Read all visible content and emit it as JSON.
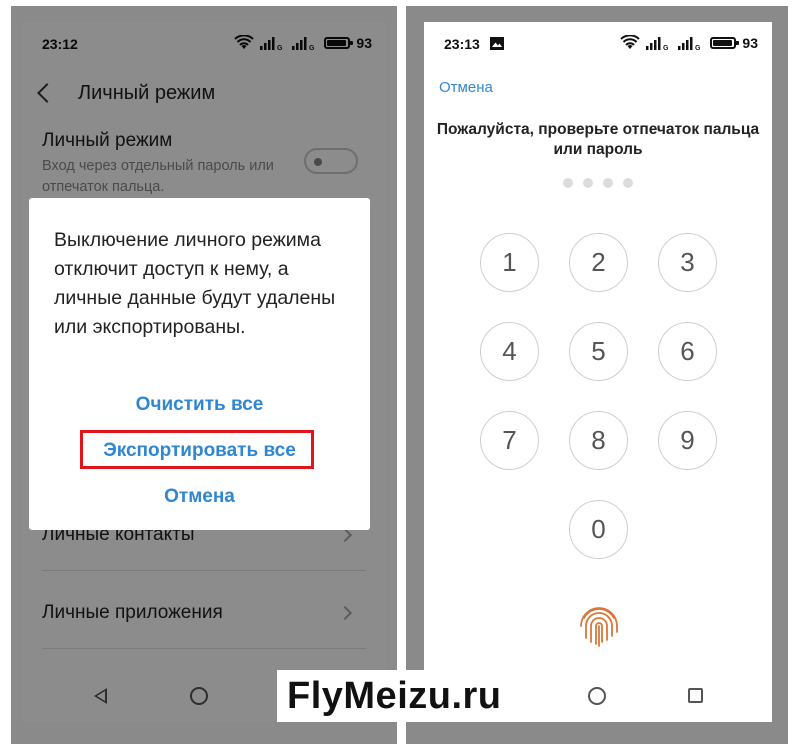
{
  "left_phone": {
    "status_bar": {
      "time": "23:12",
      "battery": "93",
      "signal_labels": [
        "G",
        "G"
      ]
    },
    "header": {
      "title": "Личный режим"
    },
    "private_mode_setting": {
      "title": "Личный режим",
      "description": "Вход через отдельный пароль или отпечаток пальца."
    },
    "list_items": [
      "Личные контакты",
      "Личные приложения"
    ],
    "dialog": {
      "message": "Выключение личного режима отключит доступ к нему, а личные данные будут удалены или экспортированы.",
      "clear_all": "Очистить все",
      "export_all": "Экспортировать все",
      "cancel": "Отмена"
    }
  },
  "right_phone": {
    "status_bar": {
      "time": "23:13",
      "battery": "93",
      "signal_labels": [
        "G",
        "G"
      ]
    },
    "cancel": "Отмена",
    "prompt": "Пожалуйста, проверьте отпечаток пальца или пароль",
    "keypad": [
      "1",
      "2",
      "3",
      "4",
      "5",
      "6",
      "7",
      "8",
      "9",
      "0"
    ]
  },
  "watermark": "FlyMeizu.ru",
  "colors": {
    "accent": "#2f87d1",
    "highlight": "#e0151c",
    "fingerprint": "#d9773a"
  }
}
